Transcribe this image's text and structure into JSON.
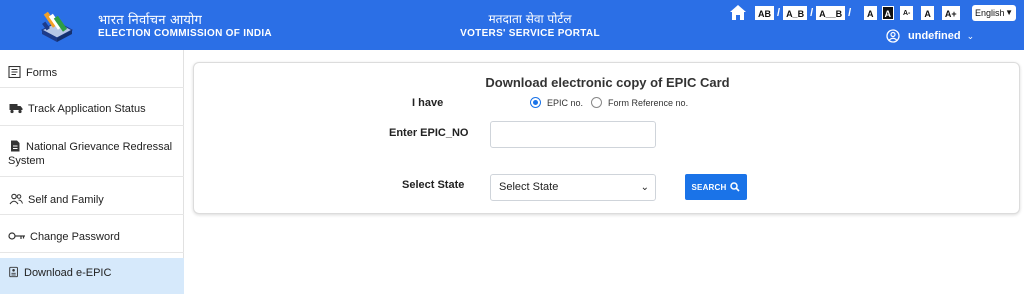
{
  "header": {
    "brand_hindi": "भारत निर्वाचन आयोग",
    "brand_english": "ELECTION COMMISSION OF INDIA",
    "portal_hindi": "मतदाता सेवा पोर्टल",
    "portal_english": "VOTERS' SERVICE PORTAL",
    "bg_color": "#2b6fe6",
    "accessibility": {
      "spacing": [
        "AB",
        "A_B",
        "A__B"
      ],
      "separator": "/",
      "contrast": [
        "A",
        "A"
      ],
      "font_size": [
        "A-",
        "A",
        "A+"
      ]
    },
    "language": "English",
    "user_name": "undefined"
  },
  "sidebar": {
    "items": [
      {
        "label": "Forms",
        "icon": "form-icon"
      },
      {
        "label": "Track Application Status",
        "icon": "truck-icon"
      },
      {
        "label": "National Grievance Redressal System",
        "icon": "document-icon"
      },
      {
        "label": "Self and Family",
        "icon": "users-icon"
      },
      {
        "label": "Change Password",
        "icon": "key-icon"
      },
      {
        "label": "Download e-EPIC",
        "icon": "id-card-icon",
        "active": true
      }
    ]
  },
  "form": {
    "title": "Download electronic copy of EPIC Card",
    "i_have_label": "I have",
    "radio_options": [
      {
        "label": "EPIC no.",
        "checked": true
      },
      {
        "label": "Form Reference no.",
        "checked": false
      }
    ],
    "epic_label": "Enter EPIC_NO",
    "epic_value": "",
    "state_label": "Select State",
    "state_selected": "Select State",
    "search_label": "SEARCH",
    "accent_color": "#1a73e8"
  }
}
